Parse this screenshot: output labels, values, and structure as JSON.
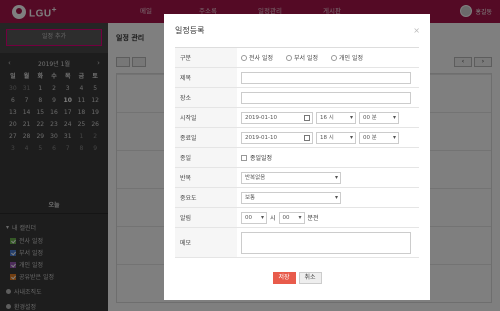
{
  "app": {
    "logo_text": "LGU",
    "logo_sup": "+"
  },
  "topnav": [
    "메일",
    "주소록",
    "일정관리",
    "게시판"
  ],
  "user": {
    "name": "홍길동"
  },
  "sidebar": {
    "add_label": "일정 추가",
    "calendar": {
      "month_label": "2019년 1월",
      "weekdays": [
        "일",
        "월",
        "화",
        "수",
        "목",
        "금",
        "토"
      ],
      "days": [
        [
          "30",
          "31",
          "1",
          "2",
          "3",
          "4",
          "5"
        ],
        [
          "6",
          "7",
          "8",
          "9",
          "10",
          "11",
          "12"
        ],
        [
          "13",
          "14",
          "15",
          "16",
          "17",
          "18",
          "19"
        ],
        [
          "20",
          "21",
          "22",
          "23",
          "24",
          "25",
          "26"
        ],
        [
          "27",
          "28",
          "29",
          "30",
          "31",
          "1",
          "2"
        ],
        [
          "3",
          "4",
          "5",
          "6",
          "7",
          "8",
          "9"
        ]
      ],
      "today_day": "10",
      "today_label": "오늘"
    },
    "my_calendar_title": "내 캘린더",
    "my_calendars": [
      {
        "label": "전사 일정",
        "color": "#6ab04c"
      },
      {
        "label": "부서 일정",
        "color": "#4a7fd6"
      },
      {
        "label": "개인 일정",
        "color": "#9b59b6"
      },
      {
        "label": "공유받은 일정",
        "color": "#e67e22"
      }
    ],
    "links": [
      "사내조직도",
      "환경설정"
    ]
  },
  "main": {
    "title": "일정 관리"
  },
  "modal": {
    "title": "일정등록",
    "close": "×",
    "fields": {
      "type_label": "구분",
      "type_options": [
        "전사 일정",
        "부서 일정",
        "개인 일정"
      ],
      "subject_label": "제목",
      "subject_value": "",
      "place_label": "장소",
      "place_value": "",
      "start_label": "시작일",
      "start_date": "2019-01-10",
      "start_hour": "16 시",
      "start_min": "00 분",
      "end_label": "종료일",
      "end_date": "2019-01-10",
      "end_hour": "18 시",
      "end_min": "00 분",
      "allday_label": "종일",
      "allday_text": "종일일정",
      "repeat_label": "반복",
      "repeat_value": "반복없음",
      "priority_label": "중요도",
      "priority_value": "보통",
      "alarm_label": "알림",
      "alarm_hour": "00",
      "alarm_hour_unit": "시",
      "alarm_min": "00",
      "alarm_min_unit": "분전",
      "memo_label": "메모",
      "memo_value": ""
    },
    "save_label": "저장",
    "cancel_label": "취소"
  },
  "colors": {
    "brand": "#a8154a",
    "accent_pink": "#e4007f",
    "save_button": "#e85b4b"
  }
}
